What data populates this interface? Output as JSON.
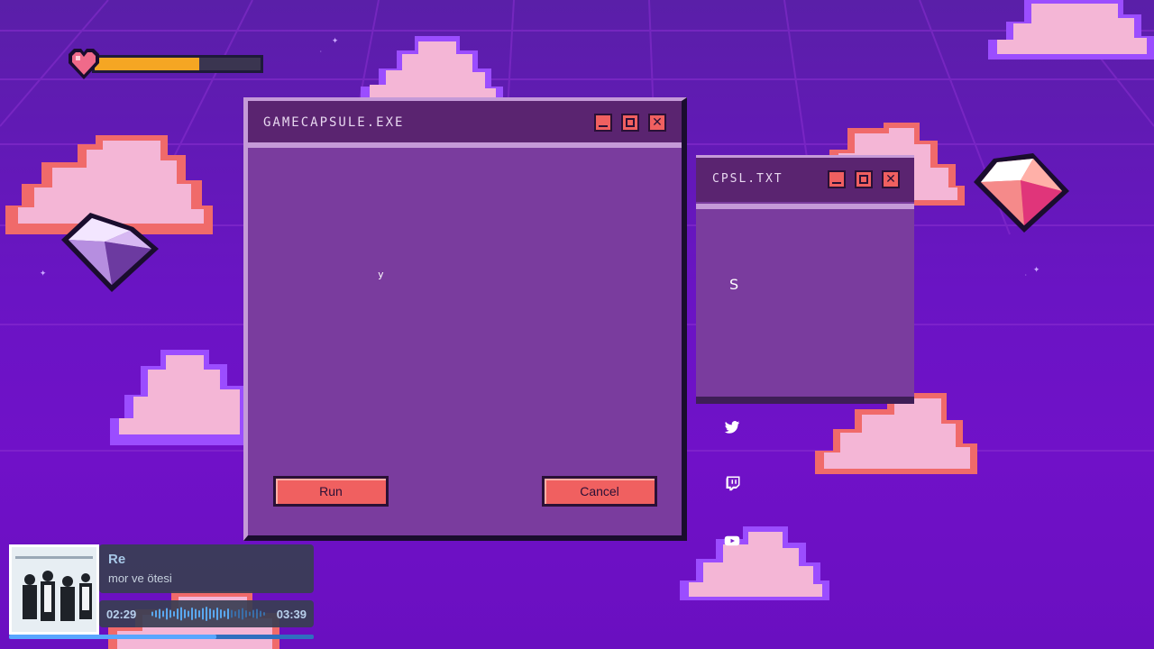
{
  "health_bar": {
    "fill_fraction": 0.63
  },
  "main_window": {
    "title": "GAMECAPSULE.EXE",
    "content_text": "y",
    "run_label": "Run",
    "cancel_label": "Cancel",
    "controls": [
      "minimize-icon",
      "maximize-icon",
      "close-icon"
    ]
  },
  "side_window": {
    "title": "CPSL.TXT",
    "content_text": "S",
    "controls": [
      "minimize-icon",
      "maximize-icon",
      "close-icon"
    ]
  },
  "social_icons": [
    "twitter-icon",
    "twitch-icon",
    "youtube-icon"
  ],
  "now_playing": {
    "song": "Re",
    "artist": "mor ve ötesi",
    "elapsed": "02:29",
    "total": "03:39",
    "progress_fraction": 0.68
  },
  "colors": {
    "background": "#6a14c4",
    "window_body": "#7a3c9e",
    "titlebar": "#5a2470",
    "button": "#f06060",
    "health_fill": "#f5a623",
    "cloud_pink": "#f4b6d6",
    "cloud_coral": "#f06a6a",
    "cloud_violet": "#9b4dff"
  }
}
